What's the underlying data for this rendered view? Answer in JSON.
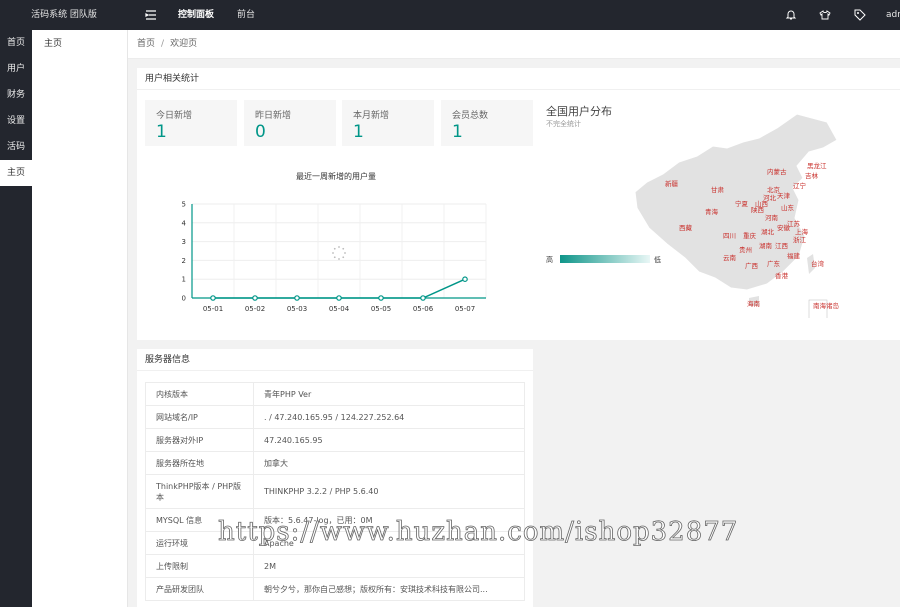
{
  "topbar": {
    "brand": "活码系统 团队版",
    "nav": [
      {
        "label": "控制面板",
        "active": true
      },
      {
        "label": "前台",
        "active": false
      }
    ],
    "user": "adr",
    "icons": [
      "menu-icon",
      "bell-icon",
      "shirt-icon",
      "tag-icon"
    ]
  },
  "rail": [
    {
      "label": "首页",
      "active": false
    },
    {
      "label": "用户",
      "active": false
    },
    {
      "label": "财务",
      "active": false
    },
    {
      "label": "设置",
      "active": false
    },
    {
      "label": "活码",
      "active": false
    },
    {
      "label": "主页",
      "active": true
    }
  ],
  "subnav": [
    {
      "label": "主页"
    }
  ],
  "breadcrumb": {
    "home": "首页",
    "sep": "/",
    "current": "欢迎页"
  },
  "stats_card": {
    "title": "用户相关统计",
    "stats": [
      {
        "label": "今日新增",
        "value": "1"
      },
      {
        "label": "昨日新增",
        "value": "0"
      },
      {
        "label": "本月新增",
        "value": "1"
      },
      {
        "label": "会员总数",
        "value": "1"
      }
    ]
  },
  "chart_data": {
    "type": "line",
    "title": "最近一周新增的用户量",
    "categories": [
      "05-01",
      "05-02",
      "05-03",
      "05-04",
      "05-05",
      "05-06",
      "05-07"
    ],
    "series": [
      {
        "values": [
          0,
          0,
          0,
          0,
          0,
          0,
          1
        ]
      }
    ],
    "ylim": [
      0,
      5
    ],
    "yticks": [
      "0",
      "1",
      "2",
      "3",
      "4",
      "5"
    ],
    "color": "#009688",
    "grid": true
  },
  "map": {
    "title": "全国用户分布",
    "subtitle": "不完全统计",
    "legend_high": "高",
    "legend_low": "低",
    "provinces": [
      "新疆",
      "西藏",
      "青海",
      "甘肃",
      "内蒙古",
      "黑龙江",
      "吉林",
      "辽宁",
      "北京",
      "天津",
      "河北",
      "山西",
      "宁夏",
      "陕西",
      "山东",
      "河南",
      "江苏",
      "安徽",
      "上海",
      "四川",
      "重庆",
      "湖北",
      "浙江",
      "贵州",
      "湖南",
      "江西",
      "福建",
      "云南",
      "广西",
      "广东",
      "台湾",
      "香港",
      "海南",
      "南海诸岛"
    ]
  },
  "server_card": {
    "title": "服务器信息",
    "rows": [
      {
        "key": "内核版本",
        "value": "青年PHP Ver"
      },
      {
        "key": "网站域名/IP",
        "value": ". / 47.240.165.95 / 124.227.252.64"
      },
      {
        "key": "服务器对外IP",
        "value": "47.240.165.95"
      },
      {
        "key": "服务器所在地",
        "value": "加拿大"
      },
      {
        "key": "ThinkPHP版本 / PHP版本",
        "value": "THINKPHP 3.2.2 / PHP 5.6.40"
      },
      {
        "key": "MYSQL 信息",
        "value": "版本：5.6.47-log，已用：0M"
      },
      {
        "key": "运行环境",
        "value": "Apache"
      },
      {
        "key": "上传限制",
        "value": "2M"
      },
      {
        "key": "产品研发团队",
        "value": "朝兮夕兮，那你自己感想；版权所有：安琪技术科技有限公司..."
      }
    ]
  },
  "watermark": "https://www.huzhan.com/ishop32877",
  "colors": {
    "accent": "#009688",
    "dark": "#23262e",
    "map_fill": "#e3e3e3",
    "map_label": "#c9302c"
  }
}
